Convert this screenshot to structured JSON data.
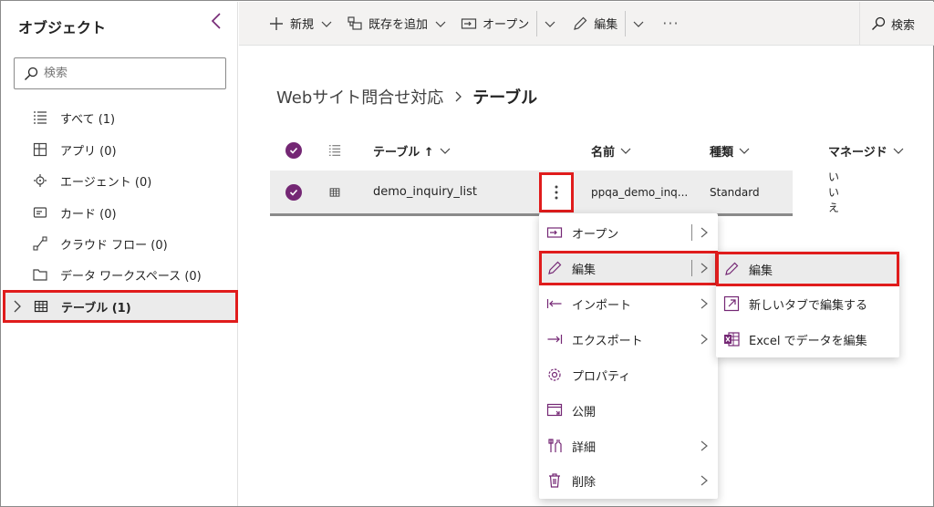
{
  "left_panel": {
    "title": "オブジェクト",
    "collapse_icon": "chevron-left-icon",
    "search_placeholder": "検索",
    "items": [
      {
        "label": "すべて (1)",
        "icon": "list-icon"
      },
      {
        "label": "アプリ (0)",
        "icon": "app-icon"
      },
      {
        "label": "エージェント (0)",
        "icon": "agent-icon"
      },
      {
        "label": "カード (0)",
        "icon": "card-icon"
      },
      {
        "label": "クラウド フロー (0)",
        "icon": "flow-icon"
      },
      {
        "label": "データ ワークスペース (0)",
        "icon": "folder-icon"
      },
      {
        "label": "テーブル (1)",
        "icon": "table-icon",
        "selected": true
      }
    ]
  },
  "toolbar": {
    "new_label": "新規",
    "add_existing_label": "既存を追加",
    "open_label": "オープン",
    "edit_label": "編集",
    "more_label": "···",
    "search_label": "検索"
  },
  "breadcrumb": {
    "parent": "Webサイト問合せ対応",
    "current": "テーブル"
  },
  "table": {
    "columns": [
      "テーブル ↑",
      "名前",
      "種類",
      "マネージド"
    ],
    "rows": [
      {
        "table": "demo_inquiry_list",
        "name": "ppqa_demo_inq...",
        "type": "Standard",
        "managed": "いいえ",
        "selected": true
      }
    ]
  },
  "context_menu": {
    "items": [
      {
        "label": "オープン",
        "icon": "open-icon",
        "submenu": true,
        "split": true
      },
      {
        "label": "編集",
        "icon": "pencil-icon",
        "submenu": true,
        "split": true,
        "highlighted": true
      },
      {
        "label": "インポート",
        "icon": "import-icon",
        "submenu": true
      },
      {
        "label": "エクスポート",
        "icon": "export-icon",
        "submenu": true
      },
      {
        "label": "プロパティ",
        "icon": "gear-icon"
      },
      {
        "label": "公開",
        "icon": "publish-icon"
      },
      {
        "label": "詳細",
        "icon": "tools-icon",
        "submenu": true
      },
      {
        "label": "削除",
        "icon": "trash-icon",
        "submenu": true
      }
    ]
  },
  "edit_submenu": {
    "items": [
      {
        "label": "編集",
        "icon": "pencil-icon",
        "highlighted": true
      },
      {
        "label": "新しいタブで編集する",
        "icon": "open-new-tab-icon"
      },
      {
        "label": "Excel でデータを編集",
        "icon": "excel-icon"
      }
    ]
  },
  "colors": {
    "accent": "#742774",
    "highlight_border": "#e01c1c",
    "selected_row": "#ededed"
  }
}
